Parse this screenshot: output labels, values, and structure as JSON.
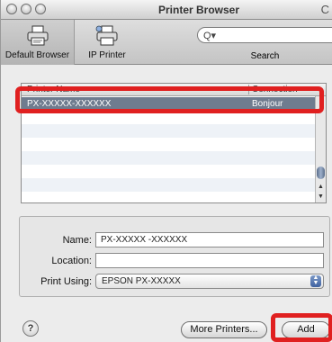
{
  "window": {
    "title": "Printer Browser",
    "title_extra": "C"
  },
  "toolbar": {
    "default_browser_label": "Default Browser",
    "ip_printer_label": "IP Printer",
    "search_label": "Search",
    "search_placeholder": "",
    "search_icon_glyph": "Q▾"
  },
  "printer_list": {
    "columns": [
      "Printer Name",
      "Connection"
    ],
    "rows": [
      {
        "name": "PX-XXXXX-XXXXXX",
        "connection": "Bonjour",
        "selected": true
      }
    ]
  },
  "form": {
    "name_label": "Name:",
    "name_value": "PX-XXXXX -XXXXXX",
    "location_label": "Location:",
    "location_value": "",
    "print_using_label": "Print Using:",
    "print_using_value": "EPSON PX-XXXXX"
  },
  "buttons": {
    "help_label": "?",
    "more_printers_label": "More Printers...",
    "add_label": "Add"
  },
  "colors": {
    "highlight": "#e02020",
    "selection": "#6f7c8f"
  }
}
